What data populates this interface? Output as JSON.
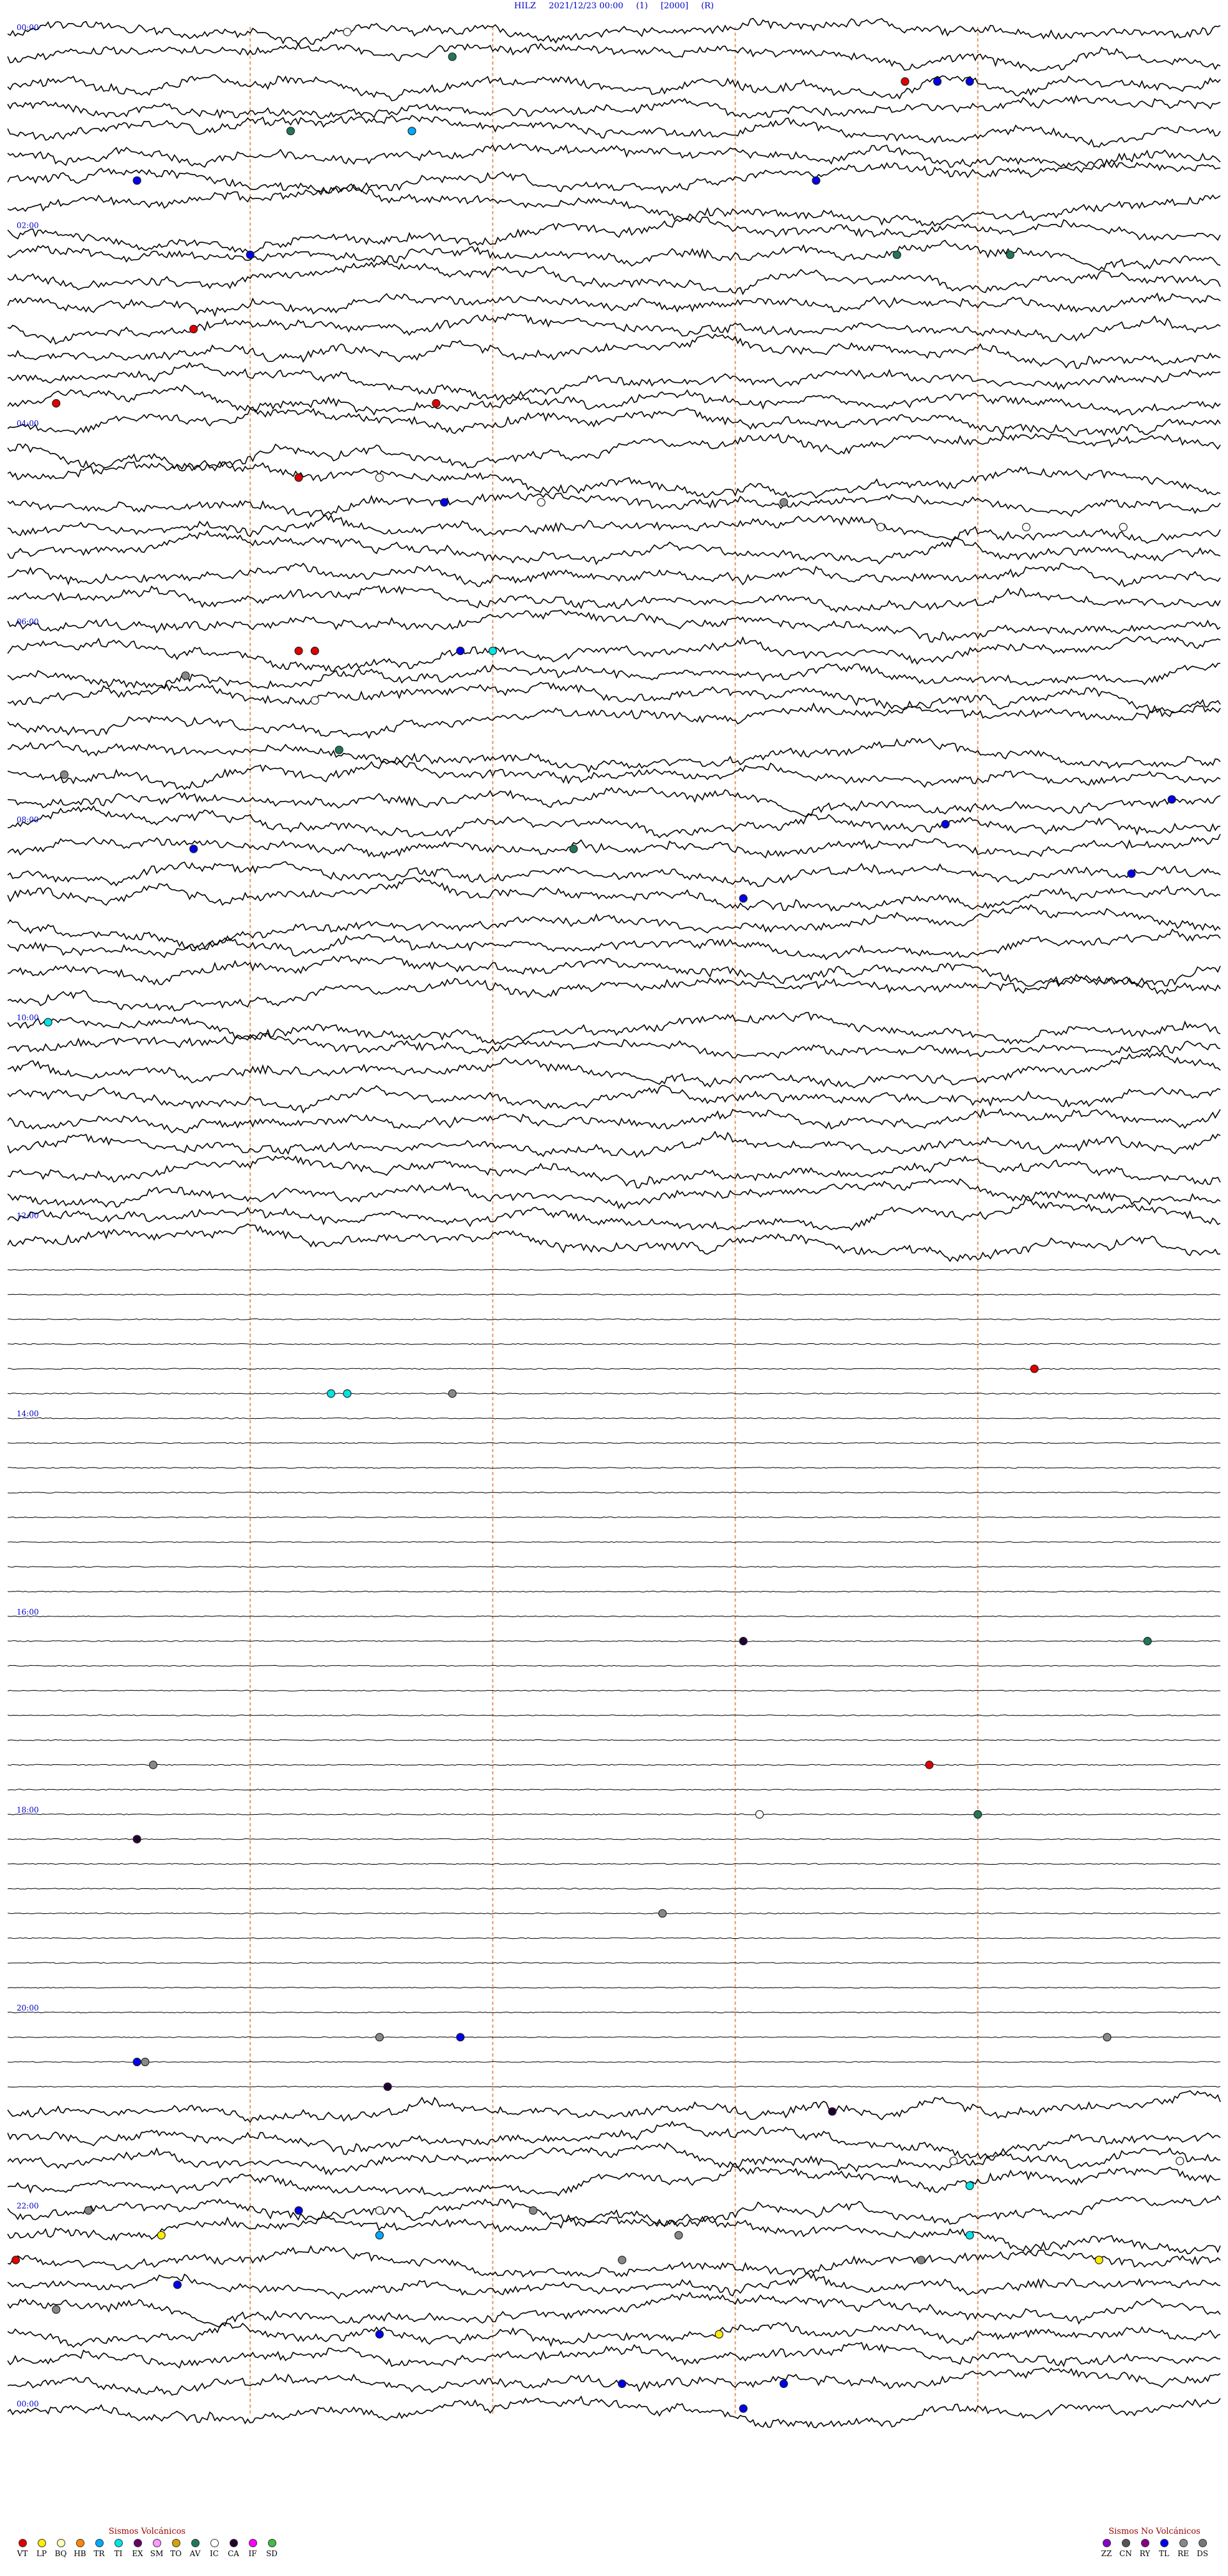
{
  "header": {
    "station": "HILZ",
    "datetime": "2021/12/23 00:00",
    "code1": "(1)",
    "code2": "[2000]",
    "code3": "(R)"
  },
  "chart_data": {
    "type": "line",
    "title": "HILZ 2021/12/23 00:00",
    "row_count": 96,
    "minutes_per_row": 15,
    "hour_labels": [
      "00:00",
      "02:00",
      "04:00",
      "06:00",
      "08:00",
      "10:00",
      "12:00",
      "14:00",
      "16:00",
      "18:00",
      "20:00",
      "22:00",
      "00:00"
    ],
    "activity_segments": [
      {
        "from_row": 0,
        "to_row": 50,
        "level": "high"
      },
      {
        "from_row": 50,
        "to_row": 84,
        "level": "low"
      },
      {
        "from_row": 84,
        "to_row": 96,
        "level": "high"
      }
    ],
    "event_markers": [
      {
        "row": 0,
        "minute": 4.2,
        "type": "IC"
      },
      {
        "row": 1,
        "minute": 5.5,
        "type": "AV"
      },
      {
        "row": 2,
        "minute": 11.1,
        "type": "VT"
      },
      {
        "row": 2,
        "minute": 11.5,
        "type": "TL"
      },
      {
        "row": 2,
        "minute": 11.9,
        "type": "TL"
      },
      {
        "row": 4,
        "minute": 3.5,
        "type": "AV"
      },
      {
        "row": 4,
        "minute": 5.0,
        "type": "TR"
      },
      {
        "row": 6,
        "minute": 1.6,
        "type": "TL"
      },
      {
        "row": 6,
        "minute": 10.0,
        "type": "TL"
      },
      {
        "row": 9,
        "minute": 3.0,
        "type": "TL"
      },
      {
        "row": 9,
        "minute": 11.0,
        "type": "AV"
      },
      {
        "row": 9,
        "minute": 12.4,
        "type": "AV"
      },
      {
        "row": 12,
        "minute": 2.3,
        "type": "VT"
      },
      {
        "row": 15,
        "minute": 0.6,
        "type": "VT"
      },
      {
        "row": 15,
        "minute": 5.3,
        "type": "VT"
      },
      {
        "row": 18,
        "minute": 3.6,
        "type": "VT"
      },
      {
        "row": 18,
        "minute": 4.6,
        "type": "IC"
      },
      {
        "row": 19,
        "minute": 5.4,
        "type": "TL"
      },
      {
        "row": 19,
        "minute": 6.6,
        "type": "IC"
      },
      {
        "row": 19,
        "minute": 9.6,
        "type": "RE"
      },
      {
        "row": 20,
        "minute": 10.8,
        "type": "IC"
      },
      {
        "row": 20,
        "minute": 12.6,
        "type": "IC"
      },
      {
        "row": 20,
        "minute": 13.8,
        "type": "IC"
      },
      {
        "row": 25,
        "minute": 3.6,
        "type": "VT"
      },
      {
        "row": 25,
        "minute": 3.8,
        "type": "VT"
      },
      {
        "row": 25,
        "minute": 5.6,
        "type": "TL"
      },
      {
        "row": 25,
        "minute": 6.0,
        "type": "TI"
      },
      {
        "row": 26,
        "minute": 2.2,
        "type": "RE"
      },
      {
        "row": 27,
        "minute": 3.8,
        "type": "IC"
      },
      {
        "row": 29,
        "minute": 4.1,
        "type": "AV"
      },
      {
        "row": 30,
        "minute": 0.7,
        "type": "RE"
      },
      {
        "row": 31,
        "minute": 14.4,
        "type": "TL"
      },
      {
        "row": 32,
        "minute": 11.6,
        "type": "TL"
      },
      {
        "row": 33,
        "minute": 2.3,
        "type": "TL"
      },
      {
        "row": 33,
        "minute": 7.0,
        "type": "AV"
      },
      {
        "row": 34,
        "minute": 13.9,
        "type": "TL"
      },
      {
        "row": 35,
        "minute": 9.1,
        "type": "TL"
      },
      {
        "row": 40,
        "minute": 0.5,
        "type": "TI"
      },
      {
        "row": 54,
        "minute": 12.7,
        "type": "VT"
      },
      {
        "row": 55,
        "minute": 4.0,
        "type": "TI"
      },
      {
        "row": 55,
        "minute": 4.2,
        "type": "TI"
      },
      {
        "row": 55,
        "minute": 5.5,
        "type": "RE"
      },
      {
        "row": 65,
        "minute": 9.1,
        "type": "CA"
      },
      {
        "row": 65,
        "minute": 14.1,
        "type": "AV"
      },
      {
        "row": 70,
        "minute": 1.8,
        "type": "RE"
      },
      {
        "row": 70,
        "minute": 11.4,
        "type": "VT"
      },
      {
        "row": 72,
        "minute": 9.3,
        "type": "IC"
      },
      {
        "row": 72,
        "minute": 12.0,
        "type": "AV"
      },
      {
        "row": 73,
        "minute": 1.6,
        "type": "CA"
      },
      {
        "row": 76,
        "minute": 8.1,
        "type": "RE"
      },
      {
        "row": 81,
        "minute": 4.6,
        "type": "RE"
      },
      {
        "row": 81,
        "minute": 5.6,
        "type": "TL"
      },
      {
        "row": 81,
        "minute": 13.6,
        "type": "RE"
      },
      {
        "row": 82,
        "minute": 1.6,
        "type": "TL"
      },
      {
        "row": 82,
        "minute": 1.7,
        "type": "RE"
      },
      {
        "row": 83,
        "minute": 4.7,
        "type": "CA"
      },
      {
        "row": 84,
        "minute": 10.2,
        "type": "CA"
      },
      {
        "row": 86,
        "minute": 11.7,
        "type": "IC"
      },
      {
        "row": 86,
        "minute": 14.5,
        "type": "IC"
      },
      {
        "row": 87,
        "minute": 11.9,
        "type": "TI"
      },
      {
        "row": 88,
        "minute": 1.0,
        "type": "RE"
      },
      {
        "row": 88,
        "minute": 3.6,
        "type": "TL"
      },
      {
        "row": 88,
        "minute": 4.6,
        "type": "IC"
      },
      {
        "row": 88,
        "minute": 6.5,
        "type": "RE"
      },
      {
        "row": 89,
        "minute": 11.9,
        "type": "TI"
      },
      {
        "row": 89,
        "minute": 1.9,
        "type": "LP"
      },
      {
        "row": 89,
        "minute": 4.6,
        "type": "TR"
      },
      {
        "row": 89,
        "minute": 8.3,
        "type": "RE"
      },
      {
        "row": 90,
        "minute": 0.1,
        "type": "VT"
      },
      {
        "row": 90,
        "minute": 7.6,
        "type": "RE"
      },
      {
        "row": 90,
        "minute": 11.3,
        "type": "RE"
      },
      {
        "row": 90,
        "minute": 13.5,
        "type": "LP"
      },
      {
        "row": 91,
        "minute": 2.1,
        "type": "TL"
      },
      {
        "row": 92,
        "minute": 0.6,
        "type": "RE"
      },
      {
        "row": 93,
        "minute": 4.6,
        "type": "TL"
      },
      {
        "row": 93,
        "minute": 8.8,
        "type": "LP"
      },
      {
        "row": 95,
        "minute": 7.6,
        "type": "TL"
      },
      {
        "row": 95,
        "minute": 9.6,
        "type": "TL"
      },
      {
        "row": 96,
        "minute": 9.1,
        "type": "TL"
      }
    ]
  },
  "legend_volcanic": {
    "title": "Sismos Volcánicos",
    "items": [
      {
        "code": "VT",
        "color": "#e00000"
      },
      {
        "code": "LP",
        "color": "#ffee00"
      },
      {
        "code": "BQ",
        "color": "#ffffbb"
      },
      {
        "code": "HB",
        "color": "#ff8800"
      },
      {
        "code": "TR",
        "color": "#00aaff"
      },
      {
        "code": "TI",
        "color": "#00e5e5"
      },
      {
        "code": "EX",
        "color": "#660066"
      },
      {
        "code": "SM",
        "color": "#ff99ff"
      },
      {
        "code": "TO",
        "color": "#d8a000"
      },
      {
        "code": "AV",
        "color": "#227755"
      },
      {
        "code": "IC",
        "color": "#ffffff"
      },
      {
        "code": "CA",
        "color": "#220033"
      },
      {
        "code": "IF",
        "color": "#ff00ff"
      },
      {
        "code": "SD",
        "color": "#44bb44"
      }
    ]
  },
  "legend_nonvolcanic": {
    "title": "Sismos No Volcánicos",
    "items": [
      {
        "code": "ZZ",
        "color": "#8800cc"
      },
      {
        "code": "CN",
        "color": "#555555"
      },
      {
        "code": "RY",
        "color": "#880088"
      },
      {
        "code": "TL",
        "color": "#0000ee"
      },
      {
        "code": "RE",
        "color": "#888888"
      },
      {
        "code": "DS",
        "color": "#777777"
      }
    ]
  }
}
